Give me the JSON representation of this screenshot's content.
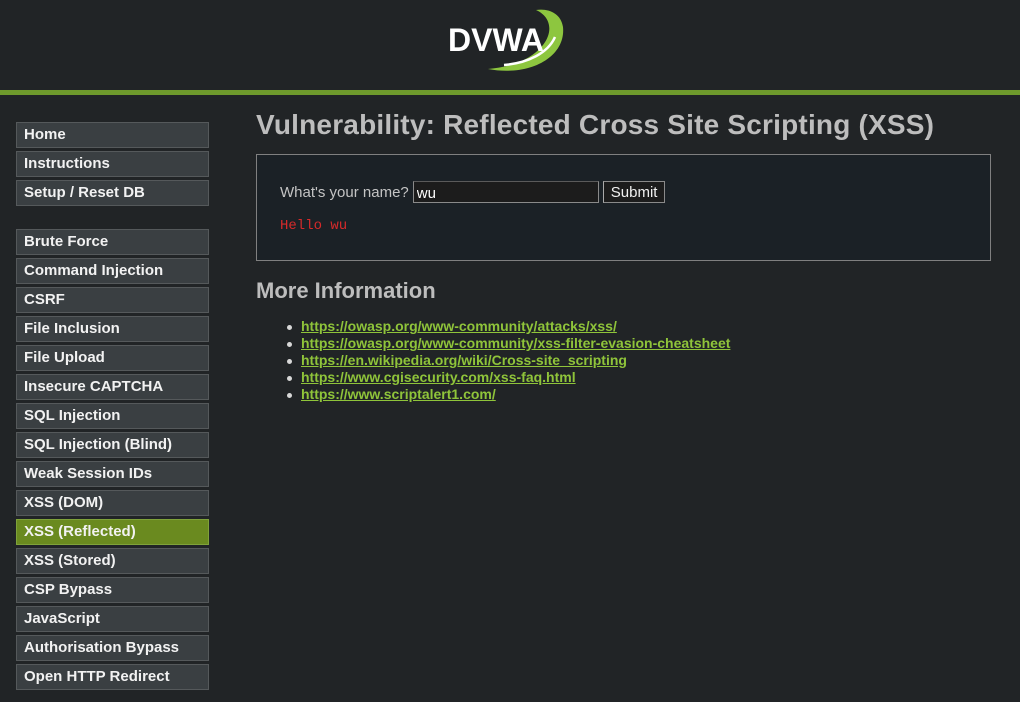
{
  "header": {
    "logo_text": "DVWA"
  },
  "sidebar": {
    "group1": [
      "Home",
      "Instructions",
      "Setup / Reset DB"
    ],
    "group2": [
      "Brute Force",
      "Command Injection",
      "CSRF",
      "File Inclusion",
      "File Upload",
      "Insecure CAPTCHA",
      "SQL Injection",
      "SQL Injection (Blind)",
      "Weak Session IDs",
      "XSS (DOM)",
      "XSS (Reflected)",
      "XSS (Stored)",
      "CSP Bypass",
      "JavaScript",
      "Authorisation Bypass",
      "Open HTTP Redirect"
    ],
    "selected": "XSS (Reflected)"
  },
  "main": {
    "title": "Vulnerability: Reflected Cross Site Scripting (XSS)",
    "form": {
      "label": "What's your name?",
      "input_value": "wu",
      "submit_label": "Submit"
    },
    "result": "Hello wu",
    "more_info_heading": "More Information",
    "links": [
      "https://owasp.org/www-community/attacks/xss/",
      "https://owasp.org/www-community/xss-filter-evasion-cheatsheet",
      "https://en.wikipedia.org/wiki/Cross-site_scripting",
      "https://www.cgisecurity.com/xss-faq.html",
      "https://www.scriptalert1.com/"
    ]
  },
  "colors": {
    "accent": "#6e9a2c",
    "selected_menu": "#6a8a1f",
    "link": "#8fc43a",
    "result_text": "#d62a2a",
    "background": "#212426"
  }
}
